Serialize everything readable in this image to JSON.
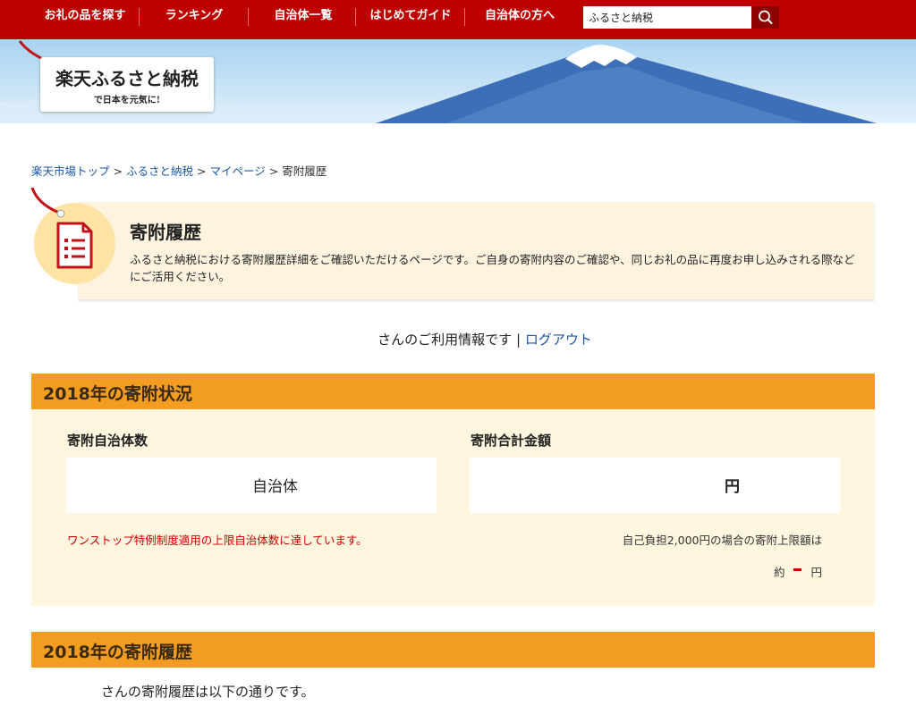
{
  "nav": {
    "items": [
      "お礼の品を探す",
      "ランキング",
      "自治体一覧",
      "はじめてガイド",
      "自治体の方へ"
    ],
    "search_value": "ふるさと納税"
  },
  "banner": {
    "logo_main": "楽天ふるさと納税",
    "logo_sub": "で日本を元気に!"
  },
  "breadcrumb": {
    "items": [
      "楽天市場トップ",
      "ふるさと納税",
      "マイページ"
    ],
    "current": "寄附履歴",
    "separator": ">"
  },
  "intro": {
    "title": "寄附履歴",
    "description": "ふるさと納税における寄附履歴詳細をご確認いただけるページです。ご自身の寄附内容のご確認や、同じお礼の品に再度お申し込みされる際などにご活用ください。"
  },
  "user_line": {
    "text": "さんのご利用情報です",
    "divider": "|",
    "logout": "ログアウト"
  },
  "status": {
    "heading": "2018年の寄附状況",
    "count_label": "寄附自治体数",
    "count_unit": "自治体",
    "amount_label": "寄附合計金額",
    "amount_unit": "円",
    "warning": "ワンストップ特例制度適用の上限自治体数に達しています。",
    "limit_note": "自己負担2,000円の場合の寄附上限額は",
    "limit_prefix": "約",
    "limit_unit": "円"
  },
  "history": {
    "heading": "2018年の寄附履歴",
    "text": "さんの寄附履歴は以下の通りです。"
  },
  "colors": {
    "nav_red": "#bf0000",
    "accent_orange": "#f29c21",
    "panel_cream": "#fff6e0",
    "link_blue": "#1a56a6",
    "warning_red": "#cc0000"
  }
}
